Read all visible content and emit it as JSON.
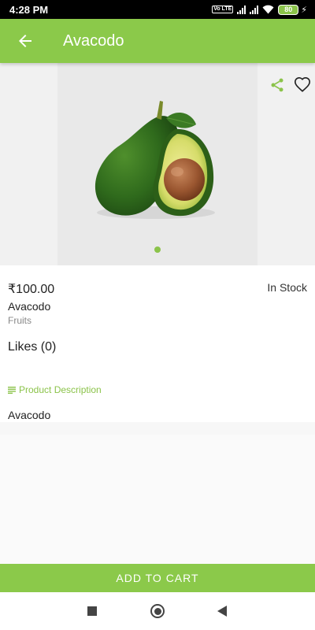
{
  "status_bar": {
    "time": "4:28 PM",
    "volte": "Vo LTE",
    "battery": "80"
  },
  "app_bar": {
    "title": "Avacodo"
  },
  "product": {
    "price": "₹100.00",
    "stock": "In Stock",
    "name": "Avacodo",
    "category": "Fruits",
    "likes": "Likes (0)",
    "description_heading": "Product Description",
    "description": "Avacodo"
  },
  "image_carousel": {
    "page_count": 1,
    "active_page": 1
  },
  "actions": {
    "add_to_cart": "ADD TO CART"
  },
  "colors": {
    "accent": "#8bc34a",
    "app_bar": "#8bc94a"
  }
}
